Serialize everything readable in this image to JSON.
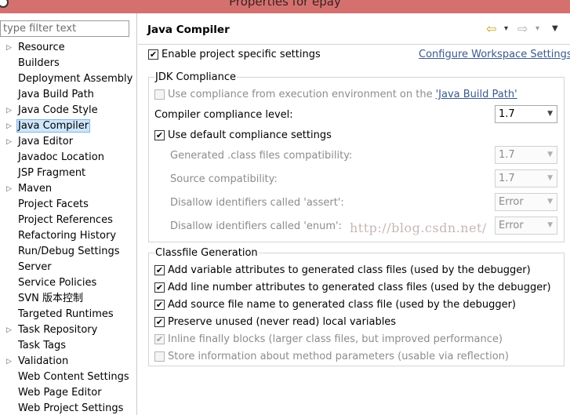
{
  "window": {
    "title": "Properties for epay"
  },
  "sidebar": {
    "filter_placeholder": "type filter text",
    "items": [
      {
        "label": "Resource",
        "expandable": true
      },
      {
        "label": "Builders",
        "expandable": false
      },
      {
        "label": "Deployment Assembly",
        "expandable": false
      },
      {
        "label": "Java Build Path",
        "expandable": false
      },
      {
        "label": "Java Code Style",
        "expandable": true
      },
      {
        "label": "Java Compiler",
        "expandable": true,
        "selected": true
      },
      {
        "label": "Java Editor",
        "expandable": true
      },
      {
        "label": "Javadoc Location",
        "expandable": false
      },
      {
        "label": "JSP Fragment",
        "expandable": false
      },
      {
        "label": "Maven",
        "expandable": true
      },
      {
        "label": "Project Facets",
        "expandable": false
      },
      {
        "label": "Project References",
        "expandable": false
      },
      {
        "label": "Refactoring History",
        "expandable": false
      },
      {
        "label": "Run/Debug Settings",
        "expandable": false
      },
      {
        "label": "Server",
        "expandable": false
      },
      {
        "label": "Service Policies",
        "expandable": false
      },
      {
        "label": "SVN 版本控制",
        "expandable": false
      },
      {
        "label": "Targeted Runtimes",
        "expandable": false
      },
      {
        "label": "Task Repository",
        "expandable": true
      },
      {
        "label": "Task Tags",
        "expandable": false
      },
      {
        "label": "Validation",
        "expandable": true
      },
      {
        "label": "Web Content Settings",
        "expandable": false
      },
      {
        "label": "Web Page Editor",
        "expandable": false
      },
      {
        "label": "Web Project Settings",
        "expandable": false
      }
    ]
  },
  "main": {
    "title": "Java Compiler",
    "nav": {
      "back": "⇦",
      "forward": "⇨",
      "dropdown": "▾",
      "menu": "▼"
    },
    "enable_specific": {
      "label": "Enable project specific settings",
      "checked": true
    },
    "configure_link": "Configure Workspace Settings...",
    "jdk": {
      "title": "JDK Compliance",
      "use_env": {
        "label_prefix": "Use compliance from execution environment on the ",
        "link": "'Java Build Path'",
        "checked": false
      },
      "level_label": "Compiler compliance level:",
      "level_value": "1.7",
      "use_default": {
        "label": "Use default compliance settings",
        "checked": true
      },
      "generated_label": "Generated .class files compatibility:",
      "generated_value": "1.7",
      "source_label": "Source compatibility:",
      "source_value": "1.7",
      "assert_label": "Disallow identifiers called 'assert':",
      "assert_value": "Error",
      "enum_label": "Disallow identifiers called 'enum':",
      "enum_value": "Error"
    },
    "classfile": {
      "title": "Classfile Generation",
      "options": [
        {
          "label": "Add variable attributes to generated class files (used by the debugger)",
          "checked": true,
          "enabled": true
        },
        {
          "label": "Add line number attributes to generated class files (used by the debugger)",
          "checked": true,
          "enabled": true
        },
        {
          "label": "Add source file name to generated class file (used by the debugger)",
          "checked": true,
          "enabled": true
        },
        {
          "label": "Preserve unused (never read) local variables",
          "checked": true,
          "enabled": true
        },
        {
          "label": "Inline finally blocks (larger class files, but improved performance)",
          "checked": true,
          "enabled": false
        },
        {
          "label": "Store information about method parameters (usable via reflection)",
          "checked": false,
          "enabled": false
        }
      ]
    },
    "watermark": "http://blog.csdn.net/"
  },
  "colors": {
    "titlebar": "#d4716f",
    "selection": "#cfe6fb",
    "link": "#3a5a8c"
  }
}
